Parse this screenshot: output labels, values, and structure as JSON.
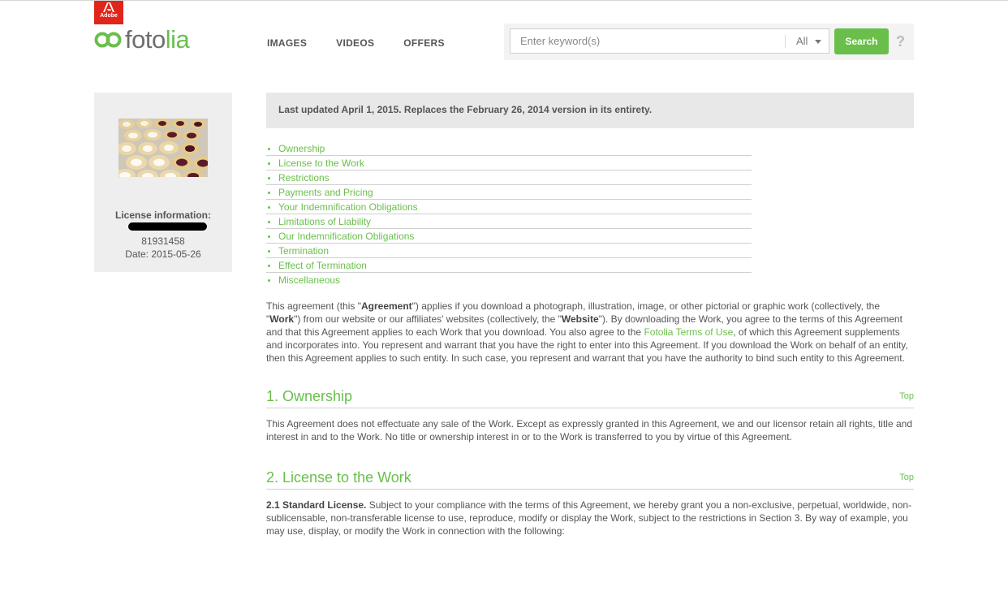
{
  "brand": {
    "adobe_label": "Adobe",
    "logo_prefix": "foto",
    "logo_suffix": "lia",
    "green": "#6abf4b",
    "adobe_red": "#e1251b"
  },
  "nav": {
    "items": [
      "IMAGES",
      "VIDEOS",
      "OFFERS"
    ]
  },
  "search": {
    "placeholder": "Enter keyword(s)",
    "category": "All",
    "button_label": "Search",
    "help_label": "?"
  },
  "sidebar": {
    "license_title": "License information:",
    "license_id": "81931458",
    "date": "Date: 2015-05-26"
  },
  "content": {
    "updated_notice": "Last updated April 1, 2015. Replaces the February 26, 2014 version in its entirety.",
    "toc": [
      "Ownership",
      "License to the Work",
      "Restrictions",
      "Payments and Pricing",
      "Your Indemnification Obligations",
      "Limitations of Liability",
      "Our Indemnification Obligations",
      "Termination",
      "Effect of Termination",
      "Miscellaneous"
    ],
    "intro": {
      "p1": "This agreement (this \"",
      "b1": "Agreement",
      "p2": "\") applies if you download a photograph, illustration, image, or other pictorial or graphic work (collectively, the \"",
      "b2": "Work",
      "p3": "\") from our website or our affiliates' websites (collectively, the \"",
      "b3": "Website",
      "p4": "\"). By downloading the Work, you agree to the terms of this Agreement and that this Agreement applies to each Work that you download. You also agree to the ",
      "link": "Fotolia Terms of Use",
      "p5": ", of which this Agreement supplements and incorporates into. You represent and warrant that you have the right to enter into this Agreement. If you download the Work on behalf of an entity, then this Agreement applies to such entity. In such case, you represent and warrant that you have the authority to bind such entity to this Agreement."
    },
    "sections": [
      {
        "title": "1. Ownership",
        "top_label": "Top",
        "body": "This Agreement does not effectuate any sale of the Work. Except as expressly granted in this Agreement, we and our licensor retain all rights, title and interest in and to the Work. No title or ownership interest in or to the Work is transferred to you by virtue of this Agreement."
      },
      {
        "title": "2. License to the Work",
        "top_label": "Top",
        "body_bold": "2.1 Standard License.",
        "body": " Subject to your compliance with the terms of this Agreement, we hereby grant you a non-exclusive, perpetual, worldwide, non-sublicensable, non-transferable license to use, reproduce, modify or display the Work, subject to the restrictions in Section 3. By way of example, you may use, display, or modify the Work in connection with the following:"
      }
    ]
  }
}
